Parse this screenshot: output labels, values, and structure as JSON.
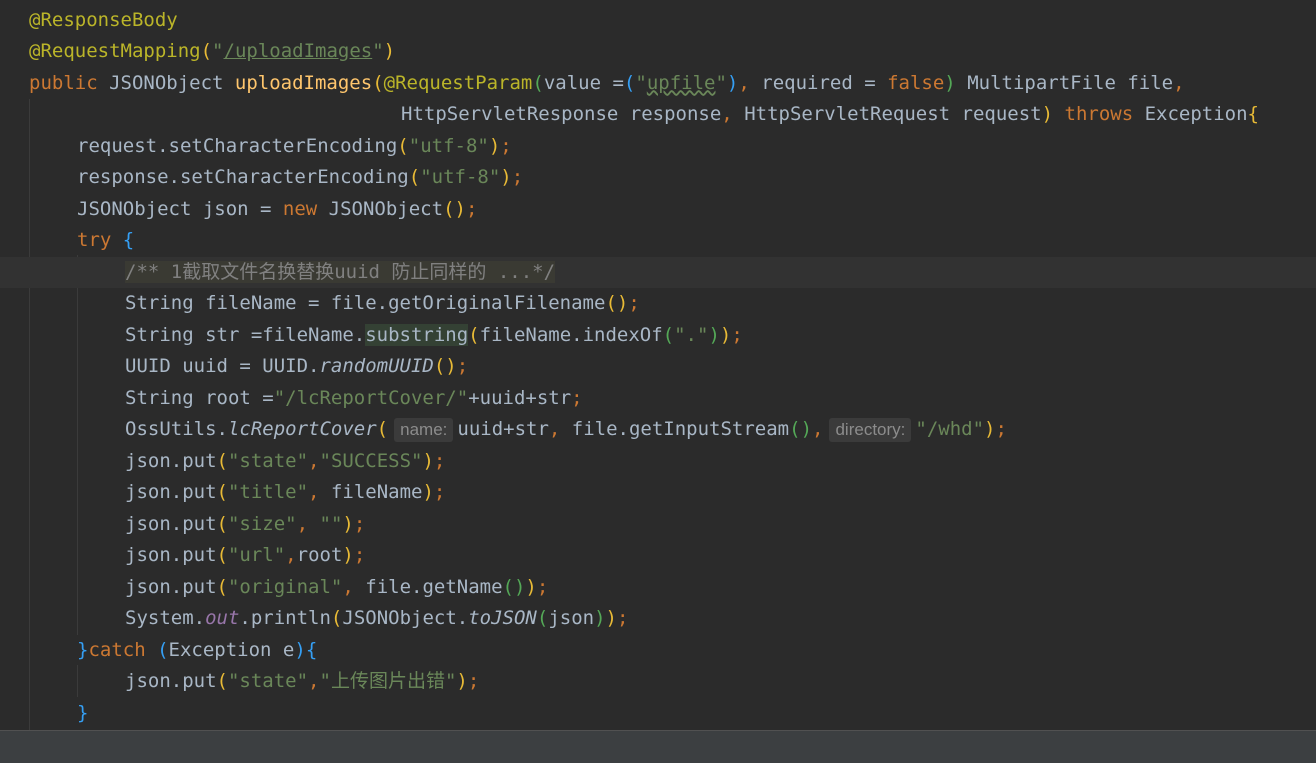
{
  "theme": {
    "background": "#2b2b2b",
    "keyword": "#cc7832",
    "string": "#6a8759",
    "annotation": "#bbb529",
    "method": "#ffc66d",
    "field": "#9876aa",
    "plain": "#a9b7c6"
  },
  "editor": {
    "highlighted_line": 8,
    "lines": [
      {
        "indent": 0,
        "tokens": [
          {
            "t": "@ResponseBody",
            "c": "ann"
          }
        ]
      },
      {
        "indent": 0,
        "tokens": [
          {
            "t": "@RequestMapping",
            "c": "ann"
          },
          {
            "t": "(",
            "c": "p1"
          },
          {
            "t": "\"",
            "c": "str"
          },
          {
            "t": "/uploadImages",
            "c": "str ul"
          },
          {
            "t": "\"",
            "c": "str"
          },
          {
            "t": ")",
            "c": "p1"
          }
        ]
      },
      {
        "indent": 0,
        "tokens": [
          {
            "t": "public ",
            "c": "kw"
          },
          {
            "t": "JSONObject ",
            "c": "plain"
          },
          {
            "t": "uploadImages",
            "c": "fn"
          },
          {
            "t": "(",
            "c": "p1"
          },
          {
            "t": "@RequestParam",
            "c": "ann"
          },
          {
            "t": "(",
            "c": "p2"
          },
          {
            "t": "value =",
            "c": "plain"
          },
          {
            "t": "(",
            "c": "p3"
          },
          {
            "t": "\"",
            "c": "str"
          },
          {
            "t": "upfile",
            "c": "str typo"
          },
          {
            "t": "\"",
            "c": "str"
          },
          {
            "t": ")",
            "c": "p3"
          },
          {
            "t": ", ",
            "c": "kw"
          },
          {
            "t": "required = ",
            "c": "plain"
          },
          {
            "t": "false",
            "c": "kw"
          },
          {
            "t": ")",
            "c": "p2"
          },
          {
            "t": " MultipartFile file",
            "c": "plain"
          },
          {
            "t": ",",
            "c": "kw"
          }
        ]
      },
      {
        "indent": 31,
        "tokens": [
          {
            "t": "HttpServletResponse response",
            "c": "plain"
          },
          {
            "t": ", ",
            "c": "kw"
          },
          {
            "t": "HttpServletRequest request",
            "c": "plain"
          },
          {
            "t": ")",
            "c": "p1"
          },
          {
            "t": " throws ",
            "c": "kw"
          },
          {
            "t": "Exception",
            "c": "plain"
          },
          {
            "t": "{",
            "c": "p1"
          }
        ]
      },
      {
        "indent": 4,
        "tokens": [
          {
            "t": "request.setCharacterEncoding",
            "c": "plain"
          },
          {
            "t": "(",
            "c": "p1"
          },
          {
            "t": "\"utf-8\"",
            "c": "str"
          },
          {
            "t": ")",
            "c": "p1"
          },
          {
            "t": ";",
            "c": "kw"
          }
        ]
      },
      {
        "indent": 4,
        "tokens": [
          {
            "t": "response.setCharacterEncoding",
            "c": "plain"
          },
          {
            "t": "(",
            "c": "p1"
          },
          {
            "t": "\"utf-8\"",
            "c": "str"
          },
          {
            "t": ")",
            "c": "p1"
          },
          {
            "t": ";",
            "c": "kw"
          }
        ]
      },
      {
        "indent": 4,
        "tokens": [
          {
            "t": "JSONObject json = ",
            "c": "plain"
          },
          {
            "t": "new ",
            "c": "kw"
          },
          {
            "t": "JSONObject",
            "c": "plain"
          },
          {
            "t": "()",
            "c": "p1"
          },
          {
            "t": ";",
            "c": "kw"
          }
        ]
      },
      {
        "indent": 4,
        "tokens": [
          {
            "t": "try ",
            "c": "kw"
          },
          {
            "t": "{",
            "c": "p3"
          }
        ]
      },
      {
        "indent": 8,
        "tokens": [
          {
            "t": "/** 1截取文件名换替换uuid 防止同样的 ...*/",
            "c": "fold"
          }
        ]
      },
      {
        "indent": 8,
        "tokens": [
          {
            "t": "String fileName = file.getOriginalFilename",
            "c": "plain"
          },
          {
            "t": "()",
            "c": "p1"
          },
          {
            "t": ";",
            "c": "kw"
          }
        ]
      },
      {
        "indent": 8,
        "tokens": [
          {
            "t": "String str =fileName.",
            "c": "plain"
          },
          {
            "t": "substring",
            "c": "plain occ"
          },
          {
            "t": "(",
            "c": "p1"
          },
          {
            "t": "fileName.indexOf",
            "c": "plain"
          },
          {
            "t": "(",
            "c": "p2"
          },
          {
            "t": "\".\"",
            "c": "str"
          },
          {
            "t": ")",
            "c": "p2"
          },
          {
            "t": ")",
            "c": "p1"
          },
          {
            "t": ";",
            "c": "kw"
          }
        ]
      },
      {
        "indent": 8,
        "tokens": [
          {
            "t": "UUID uuid = UUID.",
            "c": "plain"
          },
          {
            "t": "randomUUID",
            "c": "plain it"
          },
          {
            "t": "()",
            "c": "p1"
          },
          {
            "t": ";",
            "c": "kw"
          }
        ]
      },
      {
        "indent": 8,
        "tokens": [
          {
            "t": "String root =",
            "c": "plain"
          },
          {
            "t": "\"/lcReportCover/\"",
            "c": "str"
          },
          {
            "t": "+uuid+str",
            "c": "plain"
          },
          {
            "t": ";",
            "c": "kw"
          }
        ]
      },
      {
        "indent": 8,
        "tokens": [
          {
            "t": "OssUtils.",
            "c": "plain"
          },
          {
            "t": "lcReportCover",
            "c": "plain it"
          },
          {
            "t": "(",
            "c": "p1"
          },
          {
            "hint": "name:"
          },
          {
            "t": "uuid+str",
            "c": "plain"
          },
          {
            "t": ", ",
            "c": "kw"
          },
          {
            "t": "file.getInputStream",
            "c": "plain"
          },
          {
            "t": "()",
            "c": "p2"
          },
          {
            "t": ",",
            "c": "kw"
          },
          {
            "hint": "directory:"
          },
          {
            "t": "\"/whd\"",
            "c": "str"
          },
          {
            "t": ")",
            "c": "p1"
          },
          {
            "t": ";",
            "c": "kw"
          }
        ]
      },
      {
        "indent": 8,
        "tokens": [
          {
            "t": "json.put",
            "c": "plain"
          },
          {
            "t": "(",
            "c": "p1"
          },
          {
            "t": "\"state\"",
            "c": "str"
          },
          {
            "t": ",",
            "c": "kw"
          },
          {
            "t": "\"SUCCESS\"",
            "c": "str"
          },
          {
            "t": ")",
            "c": "p1"
          },
          {
            "t": ";",
            "c": "kw"
          }
        ]
      },
      {
        "indent": 8,
        "tokens": [
          {
            "t": "json.put",
            "c": "plain"
          },
          {
            "t": "(",
            "c": "p1"
          },
          {
            "t": "\"title\"",
            "c": "str"
          },
          {
            "t": ", ",
            "c": "kw"
          },
          {
            "t": "fileName",
            "c": "plain"
          },
          {
            "t": ")",
            "c": "p1"
          },
          {
            "t": ";",
            "c": "kw"
          }
        ]
      },
      {
        "indent": 8,
        "tokens": [
          {
            "t": "json.put",
            "c": "plain"
          },
          {
            "t": "(",
            "c": "p1"
          },
          {
            "t": "\"size\"",
            "c": "str"
          },
          {
            "t": ", ",
            "c": "kw"
          },
          {
            "t": "\"\"",
            "c": "str"
          },
          {
            "t": ")",
            "c": "p1"
          },
          {
            "t": ";",
            "c": "kw"
          }
        ]
      },
      {
        "indent": 8,
        "tokens": [
          {
            "t": "json.put",
            "c": "plain"
          },
          {
            "t": "(",
            "c": "p1"
          },
          {
            "t": "\"url\"",
            "c": "str"
          },
          {
            "t": ",",
            "c": "kw"
          },
          {
            "t": "root",
            "c": "plain"
          },
          {
            "t": ")",
            "c": "p1"
          },
          {
            "t": ";",
            "c": "kw"
          }
        ]
      },
      {
        "indent": 8,
        "tokens": [
          {
            "t": "json.put",
            "c": "plain"
          },
          {
            "t": "(",
            "c": "p1"
          },
          {
            "t": "\"original\"",
            "c": "str"
          },
          {
            "t": ", ",
            "c": "kw"
          },
          {
            "t": "file.getName",
            "c": "plain"
          },
          {
            "t": "()",
            "c": "p2"
          },
          {
            "t": ")",
            "c": "p1"
          },
          {
            "t": ";",
            "c": "kw"
          }
        ]
      },
      {
        "indent": 8,
        "tokens": [
          {
            "t": "System.",
            "c": "plain"
          },
          {
            "t": "out",
            "c": "field"
          },
          {
            "t": ".println",
            "c": "plain"
          },
          {
            "t": "(",
            "c": "p1"
          },
          {
            "t": "JSONObject.",
            "c": "plain"
          },
          {
            "t": "toJSON",
            "c": "plain it"
          },
          {
            "t": "(",
            "c": "p2"
          },
          {
            "t": "json",
            "c": "plain"
          },
          {
            "t": ")",
            "c": "p2"
          },
          {
            "t": ")",
            "c": "p1"
          },
          {
            "t": ";",
            "c": "kw"
          }
        ]
      },
      {
        "indent": 4,
        "tokens": [
          {
            "t": "}",
            "c": "p3"
          },
          {
            "t": "catch ",
            "c": "kw"
          },
          {
            "t": "(",
            "c": "p3"
          },
          {
            "t": "Exception e",
            "c": "plain"
          },
          {
            "t": ")",
            "c": "p3"
          },
          {
            "t": "{",
            "c": "p3"
          }
        ]
      },
      {
        "indent": 8,
        "tokens": [
          {
            "t": "json.put",
            "c": "plain"
          },
          {
            "t": "(",
            "c": "p1"
          },
          {
            "t": "\"state\"",
            "c": "str"
          },
          {
            "t": ",",
            "c": "kw"
          },
          {
            "t": "\"上传图片出错\"",
            "c": "str"
          },
          {
            "t": ")",
            "c": "p1"
          },
          {
            "t": ";",
            "c": "kw"
          }
        ]
      },
      {
        "indent": 4,
        "tokens": [
          {
            "t": "}",
            "c": "p3"
          }
        ]
      }
    ]
  }
}
